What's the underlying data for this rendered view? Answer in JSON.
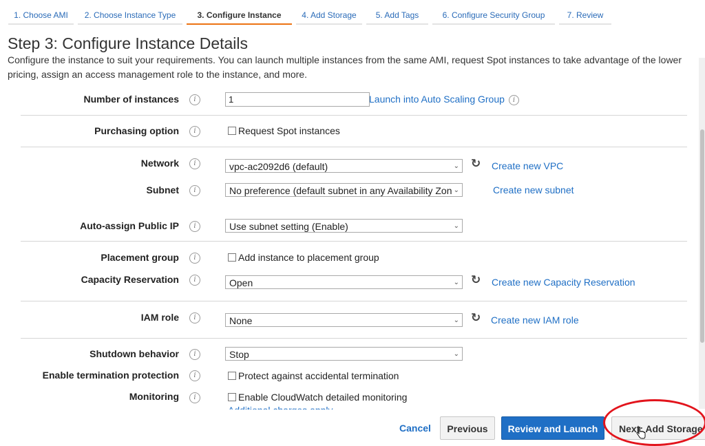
{
  "wizard": {
    "tabs": [
      {
        "label": "1. Choose AMI"
      },
      {
        "label": "2. Choose Instance Type"
      },
      {
        "label": "3. Configure Instance"
      },
      {
        "label": "4. Add Storage"
      },
      {
        "label": "5. Add Tags"
      },
      {
        "label": "6. Configure Security Group"
      },
      {
        "label": "7. Review"
      }
    ],
    "active_tab": "3. Configure Instance"
  },
  "page": {
    "title": "Step 3: Configure Instance Details",
    "description": "Configure the instance to suit your requirements. You can launch multiple instances from the same AMI, request Spot instances to take advantage of the lower pricing, assign an access management role to the instance, and more."
  },
  "form": {
    "instances": {
      "label": "Number of instances",
      "value": "1",
      "link": "Launch into Auto Scaling Group"
    },
    "purchasing": {
      "label": "Purchasing option",
      "checkbox": "Request Spot instances"
    },
    "network": {
      "label": "Network",
      "value": "vpc-ac2092d6 (default)",
      "link": "Create new VPC"
    },
    "subnet": {
      "label": "Subnet",
      "value": "No preference (default subnet in any Availability Zone",
      "link": "Create new subnet"
    },
    "public_ip": {
      "label": "Auto-assign Public IP",
      "value": "Use subnet setting (Enable)"
    },
    "placement": {
      "label": "Placement group",
      "checkbox": "Add instance to placement group"
    },
    "capacity": {
      "label": "Capacity Reservation",
      "value": "Open",
      "link": "Create new Capacity Reservation"
    },
    "iam": {
      "label": "IAM role",
      "value": "None",
      "link": "Create new IAM role"
    },
    "shutdown": {
      "label": "Shutdown behavior",
      "value": "Stop"
    },
    "termination": {
      "label": "Enable termination protection",
      "checkbox": "Protect against accidental termination"
    },
    "monitoring": {
      "label": "Monitoring",
      "checkbox": "Enable CloudWatch detailed monitoring",
      "partial_link": "Additional charges apply"
    }
  },
  "footer": {
    "cancel": "Cancel",
    "previous": "Previous",
    "review": "Review and Launch",
    "next": "Next: Add Storage"
  },
  "icons": {
    "info": "info-icon",
    "refresh": "refresh-icon",
    "chevron": "chevron-down-icon"
  },
  "colors": {
    "link": "#1f6fc5",
    "active_tab": "#ec7211",
    "primary_button": "#1f6fc5",
    "highlight": "#e2141c"
  }
}
